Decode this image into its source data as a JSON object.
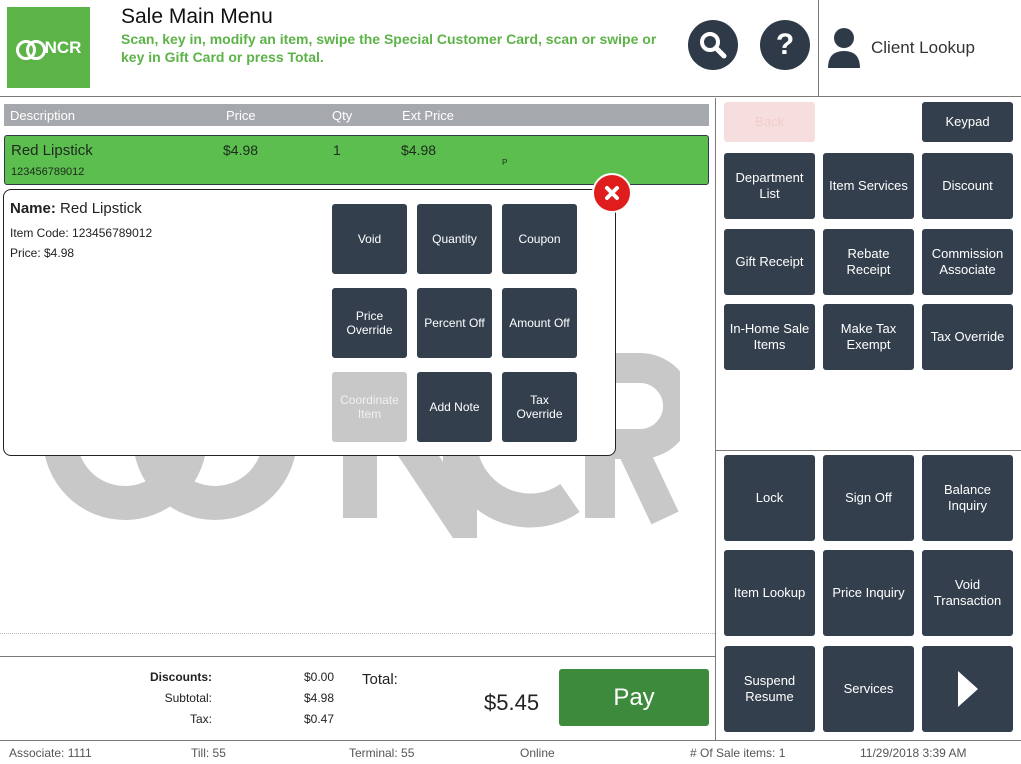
{
  "header": {
    "logo_text": "NCR",
    "title": "Sale Main Menu",
    "subtitle": "Scan, key in, modify an item, swipe the Special Customer Card, scan or swipe or key in Gift Card or press Total.",
    "search_icon": "search-icon",
    "help_label": "?",
    "client_lookup_label": "Client Lookup"
  },
  "table": {
    "columns": [
      "Description",
      "Price",
      "Qty",
      "Ext Price"
    ],
    "rows": [
      {
        "description": "Red Lipstick",
        "code": "123456789012",
        "price": "$4.98",
        "qty": "1",
        "ext_price": "$4.98",
        "flag": "P"
      }
    ]
  },
  "popup": {
    "name_label": "Name:",
    "name_value": "Red Lipstick",
    "item_code": "Item Code: 123456789012",
    "price": "Price: $4.98",
    "buttons": [
      "Void",
      "Quantity",
      "Coupon",
      "Price Override",
      "Percent Off",
      "Amount Off",
      "Coordinate Item",
      "Add Note",
      "Tax Override"
    ]
  },
  "totals": {
    "discounts_label": "Discounts:",
    "discounts_value": "$0.00",
    "subtotal_label": "Subtotal:",
    "subtotal_value": "$4.98",
    "tax_label": "Tax:",
    "tax_value": "$0.47",
    "total_label": "Total:",
    "total_value": "$5.45",
    "pay_label": "Pay"
  },
  "right_panel": {
    "back_label": "Back",
    "keypad_label": "Keypad",
    "top_buttons": [
      "Department List",
      "Item Services",
      "Discount",
      "Gift Receipt",
      "Rebate Receipt",
      "Commission Associate",
      "In-Home Sale Items",
      "Make Tax Exempt",
      "Tax Override"
    ],
    "bottom_buttons": [
      "Lock",
      "Sign Off",
      "Balance Inquiry",
      "Item Lookup",
      "Price Inquiry",
      "Void Transaction",
      "Suspend Resume",
      "Services"
    ],
    "next_icon": "chevron-right-icon"
  },
  "status_bar": {
    "associate": "Associate: 1111",
    "till": "Till: 55",
    "terminal": "Terminal: 55",
    "online": "Online",
    "sale_items": "# Of Sale items: 1",
    "datetime": "11/29/2018 3:39 AM"
  },
  "colors": {
    "brand_green": "#5cb347",
    "button_dark": "#343f4d",
    "pay_green": "#3d8a3d",
    "close_red": "#e01d1d"
  }
}
